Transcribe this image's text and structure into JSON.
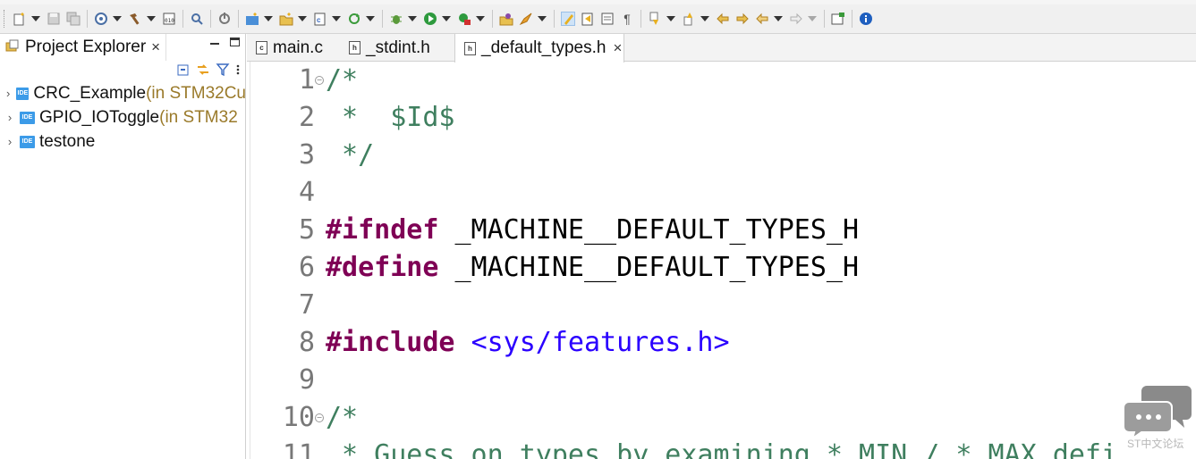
{
  "toolbar": {
    "icons": [
      "new-icon",
      "save-icon",
      "save-all-icon",
      "build-settings-icon",
      "build-icon",
      "binary-icon",
      "debug-search-icon",
      "toggle-icon",
      "new-project-icon",
      "new-folder-icon",
      "new-source-icon",
      "refresh-icon",
      "debug-icon",
      "run-icon",
      "external-tools-icon",
      "open-type-icon",
      "launch-icon",
      "highlight-icon",
      "toggle-mark-icon",
      "block-select-icon",
      "show-whitespace-icon",
      "next-annotation-icon",
      "prev-annotation-icon",
      "last-edit-icon",
      "forward-edit-icon",
      "back-icon",
      "forward-icon",
      "open-perspective-icon",
      "info-icon"
    ]
  },
  "explorer": {
    "tab_label": "Project Explorer",
    "close_glyph": "×",
    "projects": [
      {
        "name": "CRC_Example",
        "decoration": " (in STM32Cu",
        "badge": "IDE"
      },
      {
        "name": "GPIO_IOToggle",
        "decoration": " (in STM32",
        "badge": "IDE"
      },
      {
        "name": "testone",
        "decoration": "",
        "badge": "IDE"
      }
    ]
  },
  "editor": {
    "tabs": [
      {
        "label": "main.c",
        "icon": "c"
      },
      {
        "label": "_stdint.h",
        "icon": "h"
      },
      {
        "label": "_default_types.h",
        "icon": "h",
        "active": true
      }
    ],
    "close_glyph": "×",
    "lines": [
      {
        "n": "1",
        "text": "/*",
        "cls": "c-comment",
        "fold": true
      },
      {
        "n": "2",
        "text": " *  $Id$",
        "cls": "c-comment"
      },
      {
        "n": "3",
        "text": " */",
        "cls": "c-comment"
      },
      {
        "n": "4",
        "text": ""
      },
      {
        "n": "5",
        "kw": "#ifndef",
        "rest": " _MACHINE__DEFAULT_TYPES_H"
      },
      {
        "n": "6",
        "kw": "#define",
        "rest": " _MACHINE__DEFAULT_TYPES_H"
      },
      {
        "n": "7",
        "text": ""
      },
      {
        "n": "8",
        "kw": "#include",
        "rest": " ",
        "inc": "<sys/features.h>"
      },
      {
        "n": "9",
        "text": ""
      },
      {
        "n": "10",
        "text": "/*",
        "cls": "c-comment",
        "fold": true
      },
      {
        "n": "11",
        "text": " * Guess on types by examining *_MIN / *_MAX defi",
        "cls": "c-comment"
      }
    ]
  },
  "watermark": {
    "text": "ST中文论坛"
  },
  "colors": {
    "comment": "#3f7f5f",
    "keyword": "#7f0055",
    "include": "#2a00ff",
    "line_number": "#787878"
  }
}
